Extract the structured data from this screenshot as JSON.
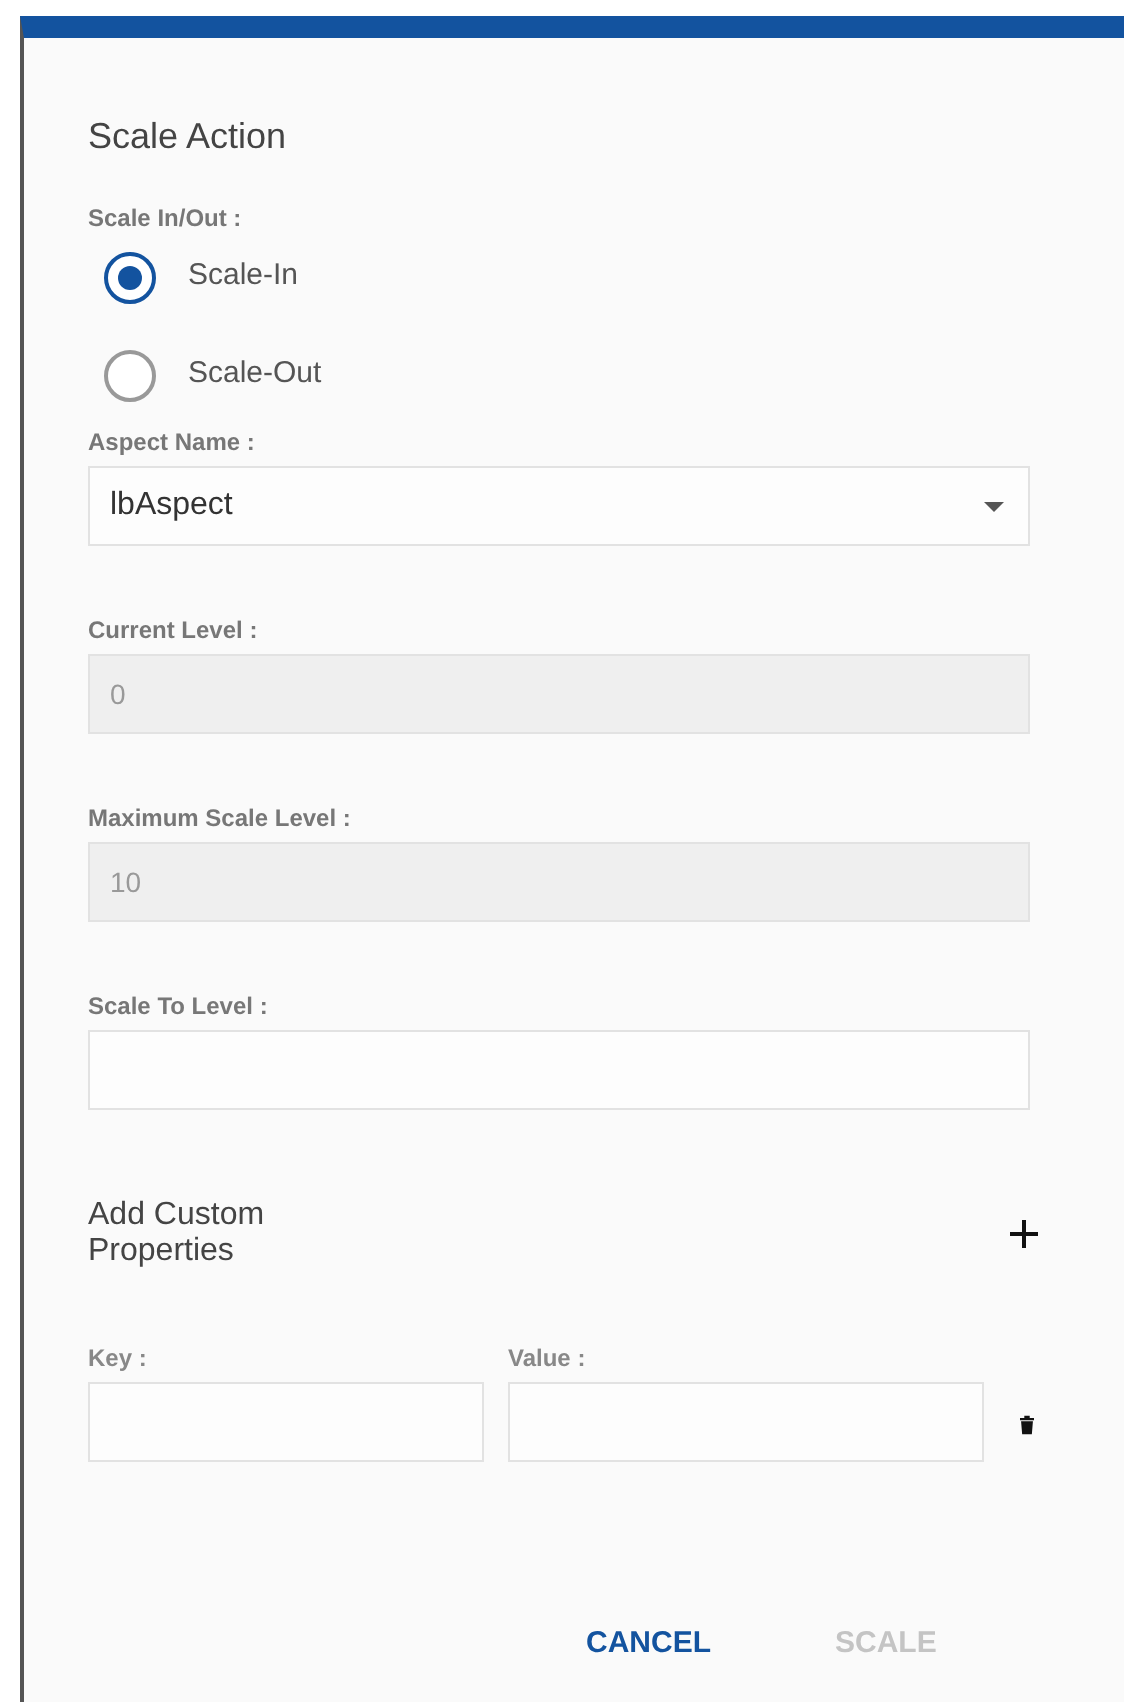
{
  "dialog": {
    "title": "Scale Action"
  },
  "scale_direction": {
    "label": "Scale In/Out :",
    "options": [
      {
        "label": "Scale-In",
        "selected": true
      },
      {
        "label": "Scale-Out",
        "selected": false
      }
    ]
  },
  "fields": [
    {
      "kind": "select",
      "label": "Aspect Name :",
      "value": "lbAspect",
      "disabled": false
    },
    {
      "kind": "text",
      "label": "Current Level :",
      "value": "0",
      "disabled": true
    },
    {
      "kind": "text",
      "label": "Maximum Scale Level :",
      "value": "10",
      "disabled": true
    },
    {
      "kind": "text",
      "label": "Scale To Level :",
      "disabled": false
    }
  ],
  "custom_properties": {
    "title": "Add Custom Properties",
    "key_label": "Key :",
    "value_label": "Value :"
  },
  "buttons": [
    {
      "label": "CANCEL",
      "disabled": false
    },
    {
      "label": "SCALE",
      "disabled": true
    }
  ]
}
